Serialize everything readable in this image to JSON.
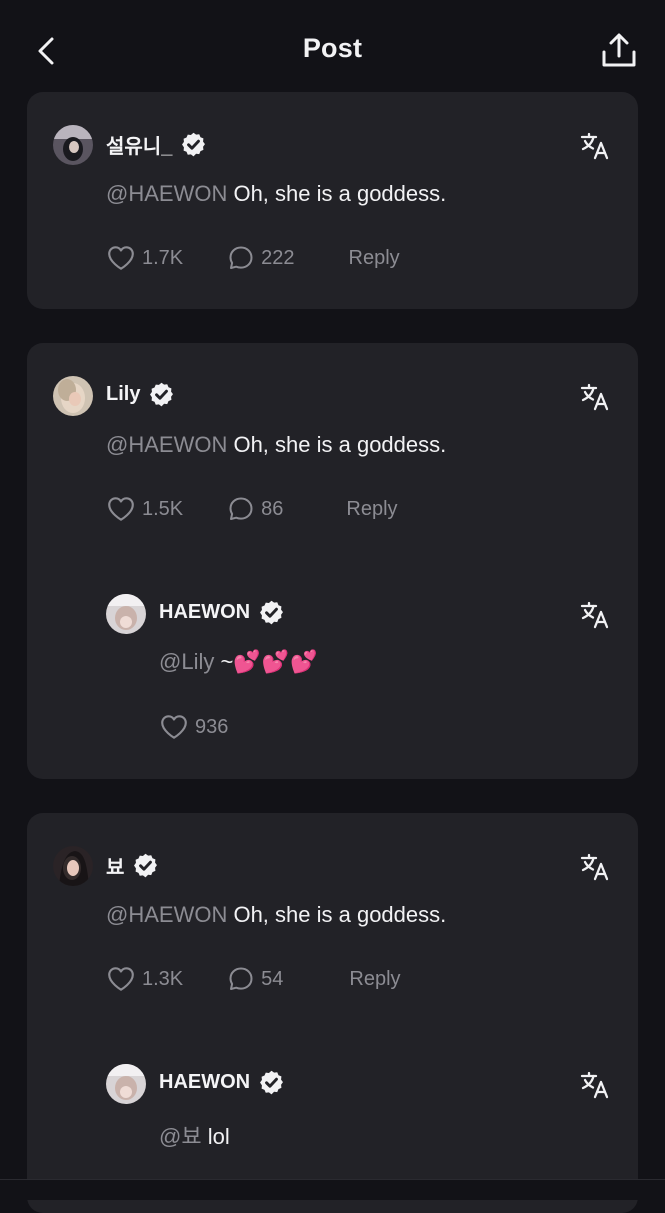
{
  "header": {
    "title": "Post",
    "back_icon": "chevron-left-icon",
    "share_icon": "share-upload-icon"
  },
  "comments": [
    {
      "username": "설유니_",
      "mention": "@HAEWON",
      "text": " Oh, she is a goddess.",
      "likes": "1.7K",
      "replies_count": "222",
      "reply_label": "Reply"
    },
    {
      "username": "Lily",
      "mention": "@HAEWON",
      "text": " Oh, she is a goddess.",
      "likes": "1.5K",
      "replies_count": "86",
      "reply_label": "Reply",
      "reply": {
        "username": "HAEWON",
        "mention": "@Lily",
        "text": " ~",
        "emoji": "💕💕💕",
        "likes": "936"
      }
    },
    {
      "username": "뵤",
      "mention": "@HAEWON",
      "text": " Oh, she is a goddess.",
      "likes": "1.3K",
      "replies_count": "54",
      "reply_label": "Reply",
      "reply": {
        "username": "HAEWON",
        "mention": "@뵤",
        "text": " lol"
      }
    }
  ],
  "colors": {
    "background": "#121217",
    "card": "#222227",
    "muted": "#8c8c93",
    "accent_heart": "#ff3aa3"
  }
}
